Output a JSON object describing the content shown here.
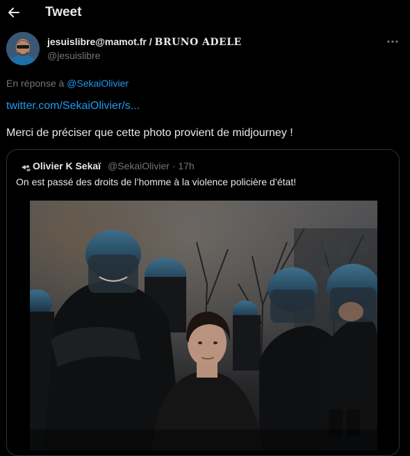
{
  "header": {
    "title": "Tweet",
    "back_icon": "arrow-left-icon"
  },
  "author": {
    "name_part1": "jesuislibre@mamot.fr / ",
    "name_part2": "BRUNO ADELE",
    "handle": "@jesuislibre",
    "avatar_icon": "user-avatar"
  },
  "reply": {
    "prefix": "En réponse à ",
    "handle": "@SekaiOlivier"
  },
  "tweet": {
    "link": "twitter.com/SekaiOlivier/s...",
    "text": "Merci de préciser que cette photo provient de midjourney !"
  },
  "more_icon": "more-horizontal-icon",
  "quote": {
    "name": "Olivier K Sekaï",
    "handle": "@SekaiOlivier",
    "separator": " · ",
    "time": "17h",
    "text": "On est passé des droits de l’homme à la violence policière d’état!"
  },
  "colors": {
    "background": "#000000",
    "text": "#e7e9ea",
    "muted": "#71767b",
    "link": "#1d9bf0",
    "border": "#2f3336"
  }
}
